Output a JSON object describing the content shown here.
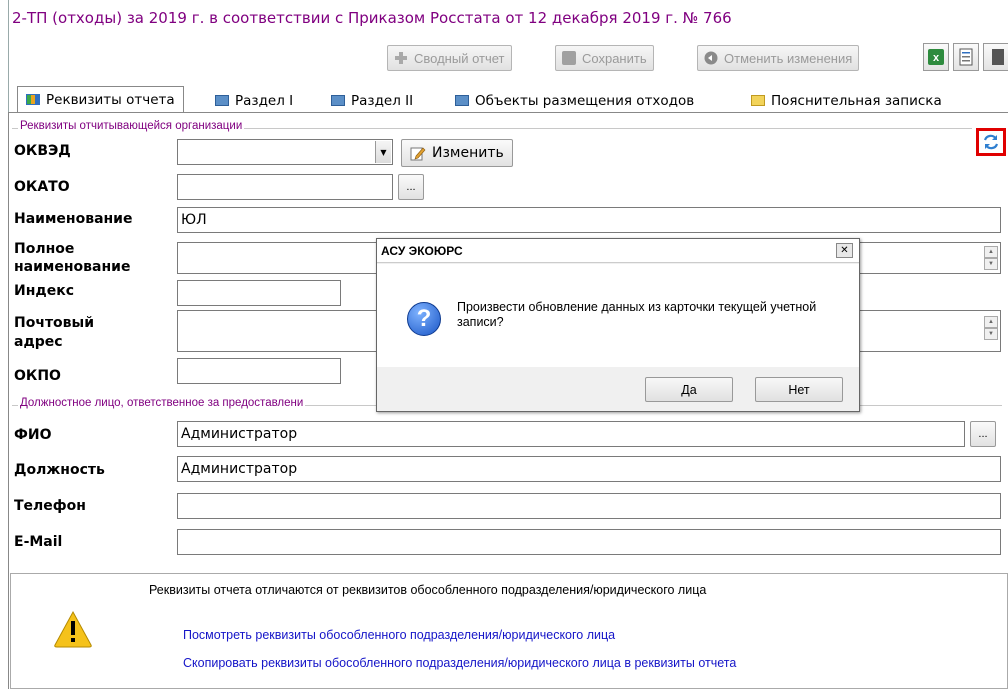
{
  "window": {
    "title": "2-ТП (отходы) за 2019 г. в соответствии с Приказом Росстата от 12 декабря 2019 г. № 766"
  },
  "toolbar": {
    "summary_label": "Сводный отчет",
    "save_label": "Сохранить",
    "cancel_label": "Отменить изменения",
    "icons": [
      "excel-icon",
      "document-icon",
      "export-icon"
    ]
  },
  "tabs": [
    {
      "label": "Реквизиты отчета",
      "active": true
    },
    {
      "label": "Раздел I"
    },
    {
      "label": "Раздел II"
    },
    {
      "label": "Объекты размещения отходов"
    },
    {
      "label": "Пояснительная записка"
    }
  ],
  "org_group": {
    "legend": "Реквизиты отчитывающейся организации",
    "okved": {
      "label": "ОКВЭД",
      "value": "",
      "edit_label": "Изменить"
    },
    "okato": {
      "label": "ОКАТО",
      "value": "",
      "picker_label": "..."
    },
    "name": {
      "label": "Наименование",
      "value": "ЮЛ"
    },
    "full_name": {
      "label_line1": "Полное",
      "label_line2": "наименование",
      "value": ""
    },
    "index": {
      "label": "Индекс",
      "value": ""
    },
    "postal": {
      "label_line1": "Почтовый",
      "label_line2": "адрес",
      "value": ""
    },
    "okpo": {
      "label": "ОКПО",
      "value": ""
    }
  },
  "official_group": {
    "legend": "Должностное лицо, ответственное за предоставлени",
    "fio": {
      "label": "ФИО",
      "value": "Администратор",
      "picker_label": "..."
    },
    "position": {
      "label": "Должность",
      "value": "Администратор"
    },
    "phone": {
      "label": "Телефон",
      "value": ""
    },
    "email": {
      "label": "E-Mail",
      "value": ""
    }
  },
  "notice": {
    "text": "Реквизиты отчета отличаются от реквизитов обособленного подразделения/юридического лица",
    "link_view": "Посмотреть реквизиты обособленного подразделения/юридического лица",
    "link_copy": "Скопировать реквизиты обособленного подразделения/юридического лица в реквизиты отчета"
  },
  "dialog": {
    "title": "АСУ ЭКОЮРС",
    "message": "Произвести обновление данных из карточки текущей учетной записи?",
    "yes_label": "Да",
    "no_label": "Нет"
  },
  "colors": {
    "title": "#800080",
    "link": "#1515c8",
    "highlight": "#e00000"
  }
}
